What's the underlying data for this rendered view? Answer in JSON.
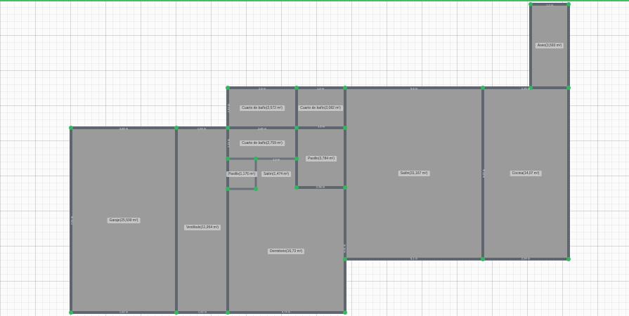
{
  "plan": {
    "rooms": [
      {
        "name": "Garaje(25,599 m²)"
      },
      {
        "name": "Vestíbulo(11,954 m²)"
      },
      {
        "name": "Dormitorio(16,73 m²)"
      },
      {
        "name": "Pasillo(1,176 m²)"
      },
      {
        "name": "Salón(1,474 m²)"
      },
      {
        "name": "Cuarto de baño(2,759 m²)"
      },
      {
        "name": "Cuarto de baño(2,572 m²)"
      },
      {
        "name": "Cuarto de baño(2,082 m²)"
      },
      {
        "name": "Pasillo(3,784 m²)"
      },
      {
        "name": "Salón(31,167 m²)"
      },
      {
        "name": "Cocina(14,07 m²)"
      },
      {
        "name": "Aseo(3,593 m²)"
      }
    ],
    "dimensions": [
      "1,2 m",
      "1,8 m",
      "2,8 m",
      "2,95 m",
      "1,69 m",
      "3,85 m",
      "1,82 m",
      "7,51 m",
      "5,8 m",
      "1,82 m",
      "3,85 m",
      "4,74 m",
      "1,6 m",
      "1,3 m",
      "2,98 m",
      "1,43 m",
      "1,19 m",
      "5,1 m",
      "2,94 m",
      "4,55 m",
      "4,01 m"
    ]
  }
}
